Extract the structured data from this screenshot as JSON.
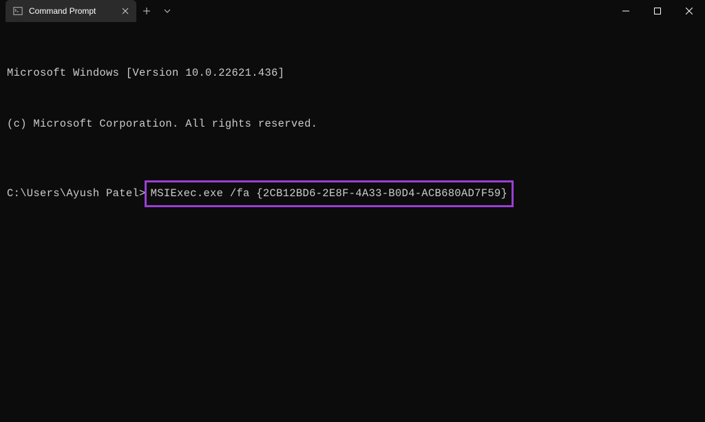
{
  "window": {
    "tab_title": "Command Prompt"
  },
  "terminal": {
    "line1": "Microsoft Windows [Version 10.0.22621.436]",
    "line2": "(c) Microsoft Corporation. All rights reserved.",
    "prompt": "C:\\Users\\Ayush Patel>",
    "command": "MSIExec.exe /fa {2CB12BD6-2E8F-4A33-B0D4-ACB680AD7F59}"
  }
}
